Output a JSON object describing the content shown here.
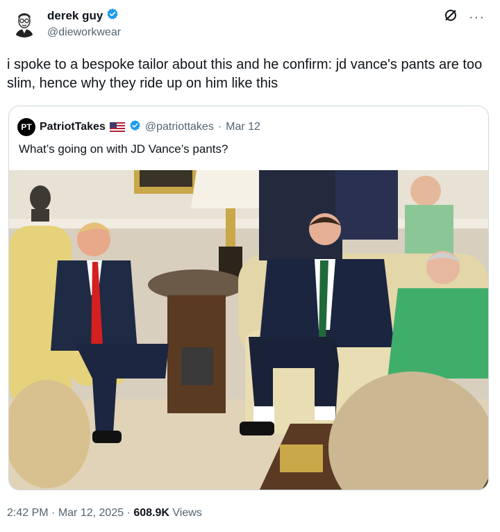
{
  "tweet": {
    "display_name": "derek guy",
    "handle": "@dieworkwear",
    "text": "i spoke to a bespoke tailor about this and he confirm: jd vance's pants are too slim, hence why they ride up on him like this",
    "time": "2:42 PM",
    "sep1": "·",
    "date": "Mar 12, 2025",
    "sep2": "·",
    "views_count": "608.9K",
    "views_label": "Views",
    "more_label": "···"
  },
  "quoted": {
    "avatar_text": "PT",
    "display_name": "PatriotTakes",
    "handle": "@patriottakes",
    "sep": "·",
    "date": "Mar 12",
    "text": "What’s going on with JD Vance’s pants?"
  },
  "colors": {
    "verified_blue": "#1d9bf0",
    "secondary_text": "#536471",
    "primary_text": "#0f1419",
    "border": "#cfd9de"
  },
  "icons": [
    "verified-badge-icon",
    "grok-icon",
    "more-icon",
    "us-flag-icon"
  ]
}
